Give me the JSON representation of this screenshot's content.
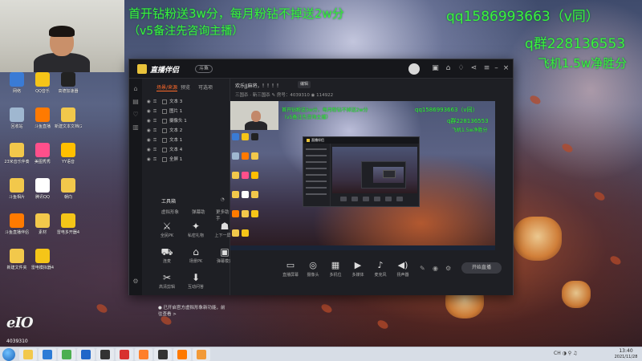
{
  "overlay": {
    "promo_line1": "首开钻粉送3w分，每月粉钻不掉送2w分",
    "promo_line2": "（v5备注先咨询主播）",
    "qq": "qq1586993663（v同）",
    "qgroup": "q群228136553",
    "fly": "飞机1.5w净胜分"
  },
  "desktop": {
    "icons": [
      {
        "label": "网络",
        "color": "#3a7bd5"
      },
      {
        "label": "QQ音乐",
        "color": "#f5c518"
      },
      {
        "label": "高德加速器",
        "color": "#222222"
      },
      {
        "label": "回收站",
        "color": "#9fb7d0"
      },
      {
        "label": "斗鱼直播",
        "color": "#ff7a00"
      },
      {
        "label": "新建文本文档(2)",
        "color": "#f2c84b"
      },
      {
        "label": "23米音乐伴奏",
        "color": "#f2c84b"
      },
      {
        "label": "美图秀秀",
        "color": "#ff4f8b"
      },
      {
        "label": "YY语音",
        "color": "#ffbf00"
      },
      {
        "label": "斗鱼相片",
        "color": "#f2c84b"
      },
      {
        "label": "腾讯QQ",
        "color": "#ffffff"
      },
      {
        "label": "朝向",
        "color": "#f2c84b"
      },
      {
        "label": "斗鱼直播伴侣",
        "color": "#ff7a00"
      },
      {
        "label": "素材",
        "color": "#f2c84b"
      },
      {
        "label": "雷电多开器4",
        "color": "#f5c518"
      },
      {
        "label": "新建文件夹",
        "color": "#f2c84b"
      },
      {
        "label": "雷电模拟器4",
        "color": "#f5c518"
      }
    ],
    "watermark_logo": "eIO",
    "watermark_num": "4039310"
  },
  "app": {
    "title": "直播伴侣",
    "badge": "斗鱼",
    "username": "",
    "scene_tabs": [
      "场景/来源",
      "预览",
      "可选项"
    ],
    "sources": [
      {
        "label": "文本 3"
      },
      {
        "label": "图片 1"
      },
      {
        "label": "摄像头 1"
      },
      {
        "label": "文本 2"
      },
      {
        "label": "文本 1"
      },
      {
        "label": "文本 4"
      },
      {
        "label": "全屏 1"
      }
    ],
    "tools_label": "工具箱",
    "tools_small": [
      "虚拟形象",
      "弹幕助",
      "更多助手"
    ],
    "tools_big": [
      {
        "label": "全民PK",
        "icon": "⚔"
      },
      {
        "label": "私密礼物",
        "icon": "✦"
      },
      {
        "label": "上下一屏同",
        "icon": "☗"
      },
      {
        "label": "连麦",
        "icon": "⛟"
      },
      {
        "label": "场景PK",
        "icon": "⌂"
      },
      {
        "label": "弹幕模式",
        "icon": "▣"
      },
      {
        "label": "高清剪辑",
        "icon": "✂"
      },
      {
        "label": "互动问答",
        "icon": "⬇"
      }
    ],
    "live_title": "欢乐JJ麻将，！！！！",
    "edit_label": "编辑",
    "live_meta": "三国杀 · 新三国杀 ✎   房号：4039310   ◉ 114922",
    "bottom_notice": "● 已开启官方虚拟形象新功能，前往查看 >",
    "controls": [
      {
        "label": "直播屏幕",
        "icon": "▭"
      },
      {
        "label": "摄像头",
        "icon": "◎"
      },
      {
        "label": "多机位",
        "icon": "▦"
      },
      {
        "label": "多媒体",
        "icon": "▶"
      },
      {
        "label": "麦克风",
        "icon": "♪"
      },
      {
        "label": "扬声器",
        "icon": "◀)"
      }
    ],
    "start_label": "开始直播"
  },
  "preview": {
    "promo_line1": "首开钻粉送3w分，每月粉钻不掉送2w分",
    "promo_line2": "（v5备注先咨询主播）",
    "qq": "qq1586993663（v同）",
    "qgroup": "q群228136553",
    "fly": "飞机1.5w净胜分",
    "nested_title": "直播伴侣"
  },
  "taskbar": {
    "apps": [
      {
        "name": "explorer-icon",
        "color": "#f2c84b"
      },
      {
        "name": "media-icon",
        "color": "#2b7bd6"
      },
      {
        "name": "chrome-icon",
        "color": "#4caf50"
      },
      {
        "name": "video-icon",
        "color": "#1f66c9"
      },
      {
        "name": "game-icon",
        "color": "#333333"
      },
      {
        "name": "netease-icon",
        "color": "#d8302f"
      },
      {
        "name": "firefox-icon",
        "color": "#ff7f2a"
      },
      {
        "name": "qq-icon",
        "color": "#333333"
      },
      {
        "name": "douyu-icon",
        "color": "#ff7a00"
      },
      {
        "name": "app2-icon",
        "color": "#f29a38"
      }
    ],
    "tray": "CH ◑ ⚲ ♫",
    "time": "13:40",
    "date": "2021/11/28"
  }
}
